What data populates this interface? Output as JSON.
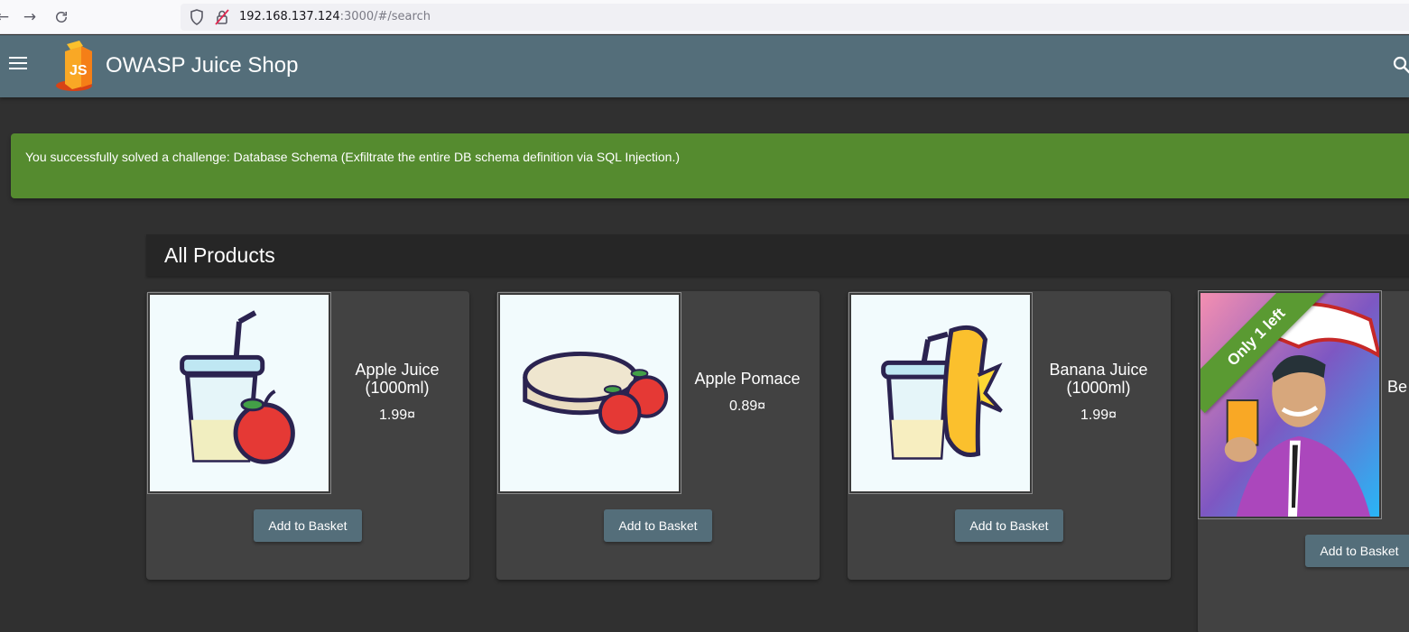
{
  "browser": {
    "url_host": "192.168.137.124",
    "url_rest": ":3000/#/search",
    "back_icon": "arrow-left",
    "forward_icon": "arrow-right",
    "reload_icon": "reload"
  },
  "app": {
    "title": "OWASP Juice Shop",
    "menu_icon": "hamburger",
    "search_icon": "magnifier",
    "toolbar_color": "#546e7a"
  },
  "notification": {
    "text": "You successfully solved a challenge: Database Schema (Exfiltrate the entire DB schema definition via SQL Injection.)",
    "color": "#558b2f"
  },
  "section": {
    "title": "All Products"
  },
  "products": [
    {
      "name": "Apple Juice (1000ml)",
      "price": "1.99¤",
      "button": "Add to Basket",
      "image": "apple-juice-image"
    },
    {
      "name": "Apple Pomace",
      "price": "0.89¤",
      "button": "Add to Basket",
      "image": "apple-pomace-image"
    },
    {
      "name": "Banana Juice (1000ml)",
      "price": "1.99¤",
      "button": "Add to Basket",
      "image": "banana-juice-image"
    },
    {
      "name": "Be",
      "ribbon": "Only 1 left",
      "button": "Add to Basket",
      "image": "juice-salesman-image"
    }
  ]
}
